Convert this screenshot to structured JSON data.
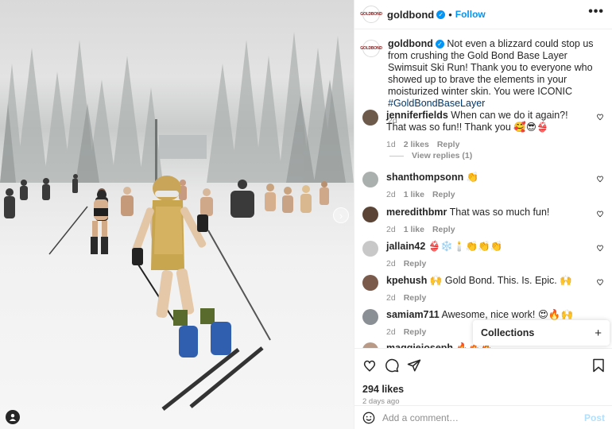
{
  "header": {
    "username": "goldbond",
    "follow_label": "Follow",
    "more_label": "•••",
    "logo_text": "GOLDBOND"
  },
  "caption": {
    "username": "goldbond",
    "text": "Not even a blizzard could stop us from crushing the Gold Bond Base Layer Swimsuit Ski Run! Thank you to everyone who showed up to brave the elements in your moisturized winter skin. You were ICONIC",
    "hashtag": "#GoldBondBaseLayer",
    "time": "2d"
  },
  "comments": [
    {
      "username": "jenniferfields",
      "text": "When can we do it again?! That was so fun!! Thank you 🥰😎👙",
      "time": "1d",
      "likes": "2 likes",
      "reply": "Reply",
      "avatar_color": "#6d5a4b"
    },
    {
      "username": "shanthompsonn",
      "text": "👏",
      "time": "2d",
      "likes": "1 like",
      "reply": "Reply",
      "avatar_color": "#a9b0ad"
    },
    {
      "username": "meredithbmr",
      "text": "That was so much fun!",
      "time": "2d",
      "likes": "1 like",
      "reply": "Reply",
      "avatar_color": "#5b4436"
    },
    {
      "username": "jallain42",
      "text": "👙❄️🕯️👏👏👏",
      "time": "2d",
      "likes": "",
      "reply": "Reply",
      "avatar_color": "#c8c8c8"
    },
    {
      "username": "kpehush",
      "text": "🙌 Gold Bond. This. Is. Epic. 🙌",
      "time": "2d",
      "likes": "",
      "reply": "Reply",
      "avatar_color": "#7a5a4a"
    },
    {
      "username": "samiam711",
      "text": "Awesome, nice work! 😍🔥🙌",
      "time": "2d",
      "likes": "",
      "reply": "Reply",
      "avatar_color": "#8a8f96"
    },
    {
      "username": "maggiejoseph",
      "text": "🔥🔥🔥",
      "time": "",
      "likes": "",
      "reply": "",
      "avatar_color": "#b89a86"
    }
  ],
  "view_replies": "View replies (1)",
  "collections": {
    "label": "Collections",
    "plus": "+"
  },
  "post_stats": {
    "likes": "294 likes",
    "ago": "2 days ago"
  },
  "add_comment": {
    "placeholder": "Add a comment…",
    "post_label": "Post"
  },
  "photo": {
    "next_glyph": "›"
  }
}
